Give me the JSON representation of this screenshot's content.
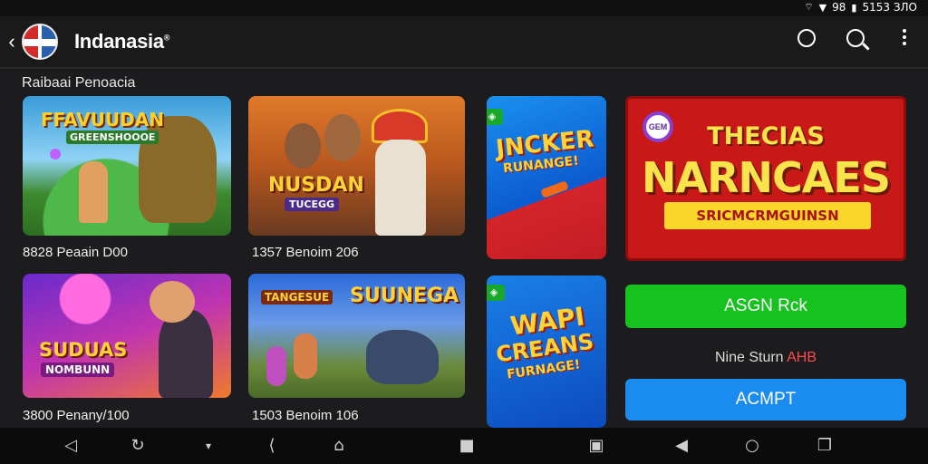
{
  "status_bar": {
    "signal_icons": "▾ ▾",
    "time": "5153 ЗЛО",
    "battery_label": "98"
  },
  "app_bar": {
    "title": "Indanasia",
    "title_mark": "®"
  },
  "section": {
    "title": "Raibaai Penoacia"
  },
  "games": [
    {
      "banner": "FFAVUUDAN",
      "sub_banner": "GREENSHOOOE",
      "caption": "8828 Peaain D00"
    },
    {
      "banner": "NUSDAN",
      "sub_banner": "TUCEGG",
      "caption": "1357 Benoim 206"
    },
    {
      "banner": "SUDUAS",
      "sub_banner": "NOMBUNN",
      "caption": "3800 Penany/100"
    },
    {
      "banner": "SUUNEGA",
      "sub_banner": "TANGESUE",
      "caption": "1503 Benoim 106"
    }
  ],
  "tall_cards": [
    {
      "line1": "JNCKER",
      "line2": "RUNANGE!"
    },
    {
      "line1": "WAPI",
      "line2": "CREANS",
      "line3": "FURNAGE!"
    }
  ],
  "promo": {
    "badge": "GEM",
    "line1": "THECIAS",
    "line2": "NARNCAES",
    "strip": "SRICMCRMGUINSN"
  },
  "buttons": {
    "primary": "ASGN Rck",
    "secondary": "ACMPT"
  },
  "promo_note": {
    "text": "Nine Sturn",
    "accent": "AHB"
  },
  "colors": {
    "promo_red": "#c81818",
    "gold": "#fbe44b",
    "green_button": "#15c21e",
    "blue_button": "#1a8cf0"
  }
}
